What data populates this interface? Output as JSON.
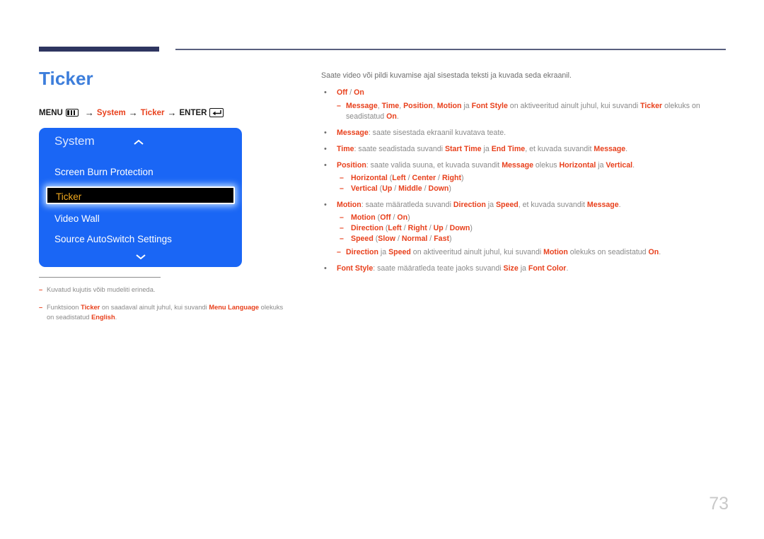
{
  "header": {
    "rule_thick_color": "#2e3560",
    "rule_thin_color": "#595f7e"
  },
  "page_title": "Ticker",
  "breadcrumb": {
    "menu_label": "MENU",
    "menu_icon": "menu-grid-icon",
    "arrow": "→",
    "step1": "System",
    "step2": "Ticker",
    "enter_label": "ENTER",
    "enter_icon": "enter-return-icon"
  },
  "osd": {
    "title": "System",
    "collapse_icon": "chevron-up-icon",
    "scroll_icon": "chevron-down-icon",
    "accent_color": "#1a66f5",
    "selected_text_color": "#f0a81e",
    "items": [
      {
        "label": "Screen Burn Protection",
        "selected": false
      },
      {
        "label": "Ticker",
        "selected": true
      },
      {
        "label": "Video Wall",
        "selected": false
      },
      {
        "label": "Source AutoSwitch Settings",
        "selected": false
      }
    ]
  },
  "footnotes": [
    {
      "mark": "–",
      "parts": [
        {
          "t": "Kuvatud kujutis võib mudeliti erineda.",
          "b": false
        }
      ]
    },
    {
      "mark": "–",
      "parts": [
        {
          "t": "Funktsioon ",
          "b": false
        },
        {
          "t": "Ticker",
          "b": true
        },
        {
          "t": " on saadaval ainult juhul, kui suvandi ",
          "b": false
        },
        {
          "t": "Menu Language",
          "b": true
        },
        {
          "t": " olekuks on seadistatud ",
          "b": false
        },
        {
          "t": "English",
          "b": true
        },
        {
          "t": ".",
          "b": false
        }
      ]
    }
  ],
  "content": {
    "intro": "Saate video või pildi kuvamise ajal sisestada teksti ja kuvada seda ekraanil.",
    "bullets": [
      {
        "mark": "•",
        "parts": [
          {
            "t": "Off",
            "b": true
          },
          {
            "t": " / ",
            "b": false
          },
          {
            "t": "On",
            "b": true
          }
        ],
        "note": {
          "mark": "–",
          "parts": [
            {
              "t": "Message",
              "b": true
            },
            {
              "t": ", ",
              "b": false
            },
            {
              "t": "Time",
              "b": true
            },
            {
              "t": ", ",
              "b": false
            },
            {
              "t": "Position",
              "b": true
            },
            {
              "t": ", ",
              "b": false
            },
            {
              "t": "Motion",
              "b": true
            },
            {
              "t": " ja ",
              "b": false
            },
            {
              "t": "Font Style",
              "b": true
            },
            {
              "t": " on aktiveeritud ainult juhul, kui suvandi ",
              "b": false
            },
            {
              "t": "Ticker",
              "b": true
            },
            {
              "t": " olekuks on seadistatud ",
              "b": false
            },
            {
              "t": "On",
              "b": true
            },
            {
              "t": ".",
              "b": false
            }
          ]
        }
      },
      {
        "mark": "•",
        "parts": [
          {
            "t": "Message",
            "b": true
          },
          {
            "t": ": saate sisestada ekraanil kuvatava teate.",
            "b": false
          }
        ]
      },
      {
        "mark": "•",
        "parts": [
          {
            "t": "Time",
            "b": true
          },
          {
            "t": ": saate seadistada suvandi ",
            "b": false
          },
          {
            "t": "Start Time",
            "b": true
          },
          {
            "t": " ja ",
            "b": false
          },
          {
            "t": "End Time",
            "b": true
          },
          {
            "t": ", et kuvada suvandit ",
            "b": false
          },
          {
            "t": "Message",
            "b": true
          },
          {
            "t": ".",
            "b": false
          }
        ]
      },
      {
        "mark": "•",
        "parts": [
          {
            "t": "Position",
            "b": true
          },
          {
            "t": ": saate valida suuna, et kuvada suvandit ",
            "b": false
          },
          {
            "t": "Message",
            "b": true
          },
          {
            "t": " olekus ",
            "b": false
          },
          {
            "t": "Horizontal",
            "b": true
          },
          {
            "t": " ja ",
            "b": false
          },
          {
            "t": "Vertical",
            "b": true
          },
          {
            "t": ".",
            "b": false
          }
        ],
        "subs": [
          {
            "mark": "–",
            "parts": [
              {
                "t": "Horizontal",
                "b": true
              },
              {
                "t": " (",
                "b": false
              },
              {
                "t": "Left",
                "b": true
              },
              {
                "t": " / ",
                "b": false
              },
              {
                "t": "Center",
                "b": true
              },
              {
                "t": " / ",
                "b": false
              },
              {
                "t": "Right",
                "b": true
              },
              {
                "t": ")",
                "b": false
              }
            ]
          },
          {
            "mark": "–",
            "parts": [
              {
                "t": "Vertical",
                "b": true
              },
              {
                "t": " (",
                "b": false
              },
              {
                "t": "Up",
                "b": true
              },
              {
                "t": " / ",
                "b": false
              },
              {
                "t": "Middle",
                "b": true
              },
              {
                "t": " / ",
                "b": false
              },
              {
                "t": "Down",
                "b": true
              },
              {
                "t": ")",
                "b": false
              }
            ]
          }
        ]
      },
      {
        "mark": "•",
        "parts": [
          {
            "t": "Motion",
            "b": true
          },
          {
            "t": ": saate määratleda suvandi ",
            "b": false
          },
          {
            "t": "Direction",
            "b": true
          },
          {
            "t": " ja ",
            "b": false
          },
          {
            "t": "Speed",
            "b": true
          },
          {
            "t": ", et kuvada suvandit ",
            "b": false
          },
          {
            "t": "Message",
            "b": true
          },
          {
            "t": ".",
            "b": false
          }
        ],
        "subs": [
          {
            "mark": "–",
            "parts": [
              {
                "t": "Motion",
                "b": true
              },
              {
                "t": " (",
                "b": false
              },
              {
                "t": "Off",
                "b": true
              },
              {
                "t": " / ",
                "b": false
              },
              {
                "t": "On",
                "b": true
              },
              {
                "t": ")",
                "b": false
              }
            ]
          },
          {
            "mark": "–",
            "parts": [
              {
                "t": "Direction",
                "b": true
              },
              {
                "t": " (",
                "b": false
              },
              {
                "t": "Left",
                "b": true
              },
              {
                "t": " / ",
                "b": false
              },
              {
                "t": "Right",
                "b": true
              },
              {
                "t": " / ",
                "b": false
              },
              {
                "t": "Up",
                "b": true
              },
              {
                "t": " / ",
                "b": false
              },
              {
                "t": "Down",
                "b": true
              },
              {
                "t": ")",
                "b": false
              }
            ]
          },
          {
            "mark": "–",
            "parts": [
              {
                "t": "Speed",
                "b": true
              },
              {
                "t": " (",
                "b": false
              },
              {
                "t": "Slow",
                "b": true
              },
              {
                "t": " / ",
                "b": false
              },
              {
                "t": "Normal",
                "b": true
              },
              {
                "t": " / ",
                "b": false
              },
              {
                "t": "Fast",
                "b": true
              },
              {
                "t": ")",
                "b": false
              }
            ]
          }
        ],
        "note": {
          "mark": "–",
          "parts": [
            {
              "t": "Direction",
              "b": true
            },
            {
              "t": " ja ",
              "b": false
            },
            {
              "t": "Speed",
              "b": true
            },
            {
              "t": " on aktiveeritud ainult juhul, kui suvandi ",
              "b": false
            },
            {
              "t": "Motion",
              "b": true
            },
            {
              "t": " olekuks on seadistatud ",
              "b": false
            },
            {
              "t": "On",
              "b": true
            },
            {
              "t": ".",
              "b": false
            }
          ]
        }
      },
      {
        "mark": "•",
        "parts": [
          {
            "t": "Font Style",
            "b": true
          },
          {
            "t": ": saate määratleda teate jaoks suvandi ",
            "b": false
          },
          {
            "t": "Size",
            "b": true
          },
          {
            "t": " ja ",
            "b": false
          },
          {
            "t": "Font Color",
            "b": true
          },
          {
            "t": ".",
            "b": false
          }
        ]
      }
    ]
  },
  "page_number": "73"
}
